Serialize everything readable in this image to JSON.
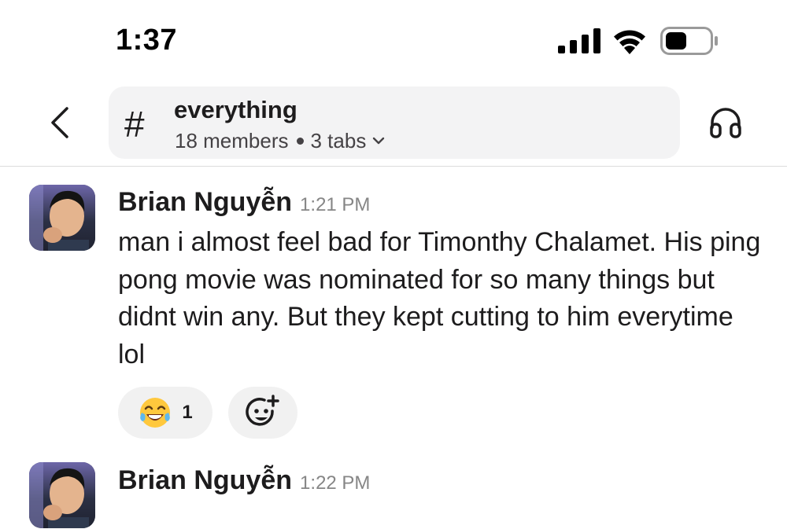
{
  "status_bar": {
    "time": "1:37",
    "icons": [
      "cellular-signal-icon",
      "wifi-icon",
      "battery-icon"
    ]
  },
  "header": {
    "channel_prefix": "#",
    "channel_name": "everything",
    "members": "18 members",
    "tabs": "3 tabs"
  },
  "messages": [
    {
      "sender": "Brian Nguyễn",
      "time": "1:21 PM",
      "text": "man i almost feel bad for Timonthy Chalamet. His ping pong movie was nominated for so many things but didnt win any. But they kept cutting to him everytime lol",
      "reactions": [
        {
          "emoji": "😂",
          "icon": "tears-of-joy-emoji",
          "count": "1"
        }
      ]
    },
    {
      "sender": "Brian Nguyễn",
      "time": "1:22 PM"
    }
  ],
  "colors": {
    "pill_bg": "#f3f3f4",
    "reaction_bg": "#f1f1f1",
    "text": "#1d1c1d",
    "muted": "#868686"
  }
}
